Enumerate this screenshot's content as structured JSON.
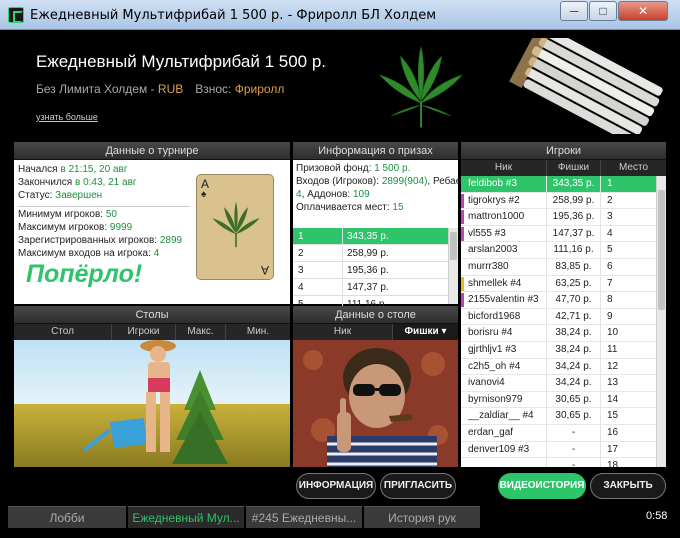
{
  "window": {
    "title": "Ежедневный Мультифрибай 1 500 р. - Фриролл БЛ Холдем",
    "min_glyph": "─",
    "max_glyph": "□",
    "close_glyph": "✕"
  },
  "header": {
    "title": "Ежедневный Мультифрибай 1 500 р.",
    "game": "Без Лимита Холдем - ",
    "currency": "RUB",
    "buyin_label": "Взнос: ",
    "buyin_value": "Фриролл",
    "more_link": "узнать больше"
  },
  "tournament": {
    "header": "Данные о турнире",
    "started_label": "Начался ",
    "started_value": "в 21:15, 20 авг",
    "ended_label": "Закончился ",
    "ended_value": "в 0:43, 21 авг",
    "status_label": "Статус: ",
    "status_value": "Завершен",
    "min_players_label": "Минимум игроков: ",
    "min_players_value": "50",
    "max_players_label": "Максимум игроков: ",
    "max_players_value": "9999",
    "registered_label": "Зарегистрированных игроков: ",
    "registered_value": "2899",
    "max_entries_label": "Максимум входов на игрока: ",
    "max_entries_value": "4",
    "card_rank": "A",
    "card_suit": "♠",
    "slogan": "Попёрло!"
  },
  "prize": {
    "header": "Информация о призах",
    "fund_label": "Призовой фонд: ",
    "fund_value": "1 500 р.",
    "entries_label": "Входов (Игроков): ",
    "entries_value": "2899(904)",
    "rebuys_label": ", Ребаев: ",
    "rebuys_value": "4",
    "addons_label": ", Аддонов: ",
    "addons_value": "109",
    "paid_label": "Оплачивается мест: ",
    "paid_value": "15",
    "rows": [
      {
        "place": "1",
        "amount": "343,35 р."
      },
      {
        "place": "2",
        "amount": "258,99 р."
      },
      {
        "place": "3",
        "amount": "195,36 р."
      },
      {
        "place": "4",
        "amount": "147,37 р."
      },
      {
        "place": "5",
        "amount": "111,16 р."
      }
    ]
  },
  "players": {
    "header": "Игроки",
    "col_nick": "Ник",
    "col_chips": "Фишки",
    "col_place": "Место",
    "rows": [
      {
        "nick": "feldibob #3",
        "chips": "343,35 р.",
        "place": "1",
        "marker": ""
      },
      {
        "nick": "tigrokrys #2",
        "chips": "258,99 р.",
        "place": "2",
        "marker": "#c040c0"
      },
      {
        "nick": "mattron1000",
        "chips": "195,36 р.",
        "place": "3",
        "marker": "#c040c0"
      },
      {
        "nick": "vl555 #3",
        "chips": "147,37 р.",
        "place": "4",
        "marker": "#c040c0"
      },
      {
        "nick": "arslan2003",
        "chips": "111,16 р.",
        "place": "5",
        "marker": ""
      },
      {
        "nick": "murrr380",
        "chips": "83,85 р.",
        "place": "6",
        "marker": ""
      },
      {
        "nick": "shmellek #4",
        "chips": "63,25 р.",
        "place": "7",
        "marker": "#e0c020"
      },
      {
        "nick": "2155valentin #3",
        "chips": "47,70 р.",
        "place": "8",
        "marker": "#c040c0"
      },
      {
        "nick": "bicford1968",
        "chips": "42,71 р.",
        "place": "9",
        "marker": ""
      },
      {
        "nick": "borisru #4",
        "chips": "38,24 р.",
        "place": "10",
        "marker": ""
      },
      {
        "nick": "gjrthljv1 #3",
        "chips": "38,24 р.",
        "place": "11",
        "marker": ""
      },
      {
        "nick": "c2h5_oh #4",
        "chips": "34,24 р.",
        "place": "12",
        "marker": ""
      },
      {
        "nick": "ivanovi4",
        "chips": "34,24 р.",
        "place": "13",
        "marker": ""
      },
      {
        "nick": "byrnison979",
        "chips": "30,65 р.",
        "place": "14",
        "marker": ""
      },
      {
        "nick": "__zaldiar__ #4",
        "chips": "30,65 р.",
        "place": "15",
        "marker": ""
      },
      {
        "nick": "erdan_gaf",
        "chips": "-",
        "place": "16",
        "marker": ""
      },
      {
        "nick": "denver109 #3",
        "chips": "-",
        "place": "17",
        "marker": ""
      },
      {
        "nick": "...",
        "chips": "-",
        "place": "18",
        "marker": ""
      }
    ]
  },
  "tables": {
    "header": "Столы",
    "col_table": "Стол",
    "col_players": "Игроки",
    "col_max": "Макс.",
    "col_min": "Мин."
  },
  "at_table": {
    "header": "Данные о столе",
    "col_nick": "Ник",
    "col_chips": "Фишки ▾"
  },
  "buttons": {
    "info": "ИНФОРМАЦИЯ",
    "invite": "ПРИГЛАСИТЬ",
    "video": "ВИДЕОИСТОРИЯ",
    "close": "ЗАКРЫТЬ"
  },
  "tabs": [
    {
      "label": "Лобби"
    },
    {
      "label": "Ежедневный Мул..."
    },
    {
      "label": "#245 Ежедневны..."
    },
    {
      "label": "История рук"
    }
  ],
  "clock": "0:58",
  "colors": {
    "accent": "#2ec46a",
    "currency": "#e0a040"
  }
}
